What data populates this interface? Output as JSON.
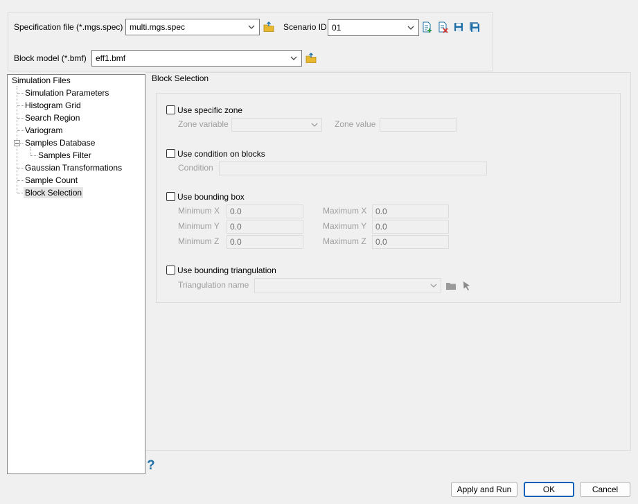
{
  "top": {
    "spec_label": "Specification file (*.mgs.spec)",
    "spec_value": "multi.mgs.spec",
    "scenario_label": "Scenario ID",
    "scenario_value": "01",
    "block_label": "Block model (*.bmf)",
    "block_value": "eff1.bmf"
  },
  "tree": {
    "root": "Simulation Files",
    "items": [
      "Simulation Parameters",
      "Histogram Grid",
      "Search Region",
      "Variogram",
      "Samples Database",
      "Samples Filter",
      "Gaussian Transformations",
      "Sample Count",
      "Block Selection"
    ],
    "selected": "Block Selection"
  },
  "section_title": "Block Selection",
  "zone": {
    "checkbox_label": "Use specific zone",
    "variable_label": "Zone variable",
    "variable_value": "",
    "value_label": "Zone value",
    "value_value": ""
  },
  "condition": {
    "checkbox_label": "Use condition on blocks",
    "field_label": "Condition",
    "field_value": ""
  },
  "bbox": {
    "checkbox_label": "Use bounding box",
    "min_x_label": "Minimum X",
    "min_y_label": "Minimum Y",
    "min_z_label": "Minimum Z",
    "max_x_label": "Maximum X",
    "max_y_label": "Maximum Y",
    "max_z_label": "Maximum Z",
    "min_x": "0.0",
    "min_y": "0.0",
    "min_z": "0.0",
    "max_x": "0.0",
    "max_y": "0.0",
    "max_z": "0.0"
  },
  "triangulation": {
    "checkbox_label": "Use bounding triangulation",
    "name_label": "Triangulation name",
    "name_value": ""
  },
  "footer": {
    "help_label": "?",
    "apply_run": "Apply and Run",
    "ok": "OK",
    "cancel": "Cancel"
  },
  "colors": {
    "folder": "#e8b830",
    "accent": "#005fb8",
    "help": "#1d6fa5"
  }
}
